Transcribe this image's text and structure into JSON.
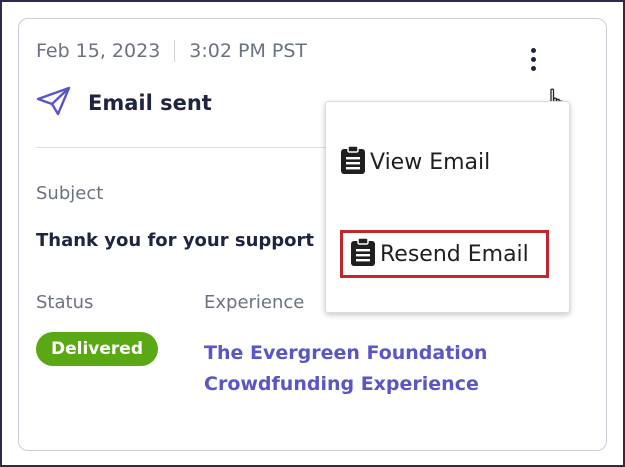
{
  "activity": {
    "date": "Feb 15, 2023",
    "time": "3:02 PM PST",
    "event_label": "Email sent"
  },
  "details": {
    "subject_label": "Subject",
    "subject_value": "Thank you for your support",
    "status_label": "Status",
    "status_value": "Delivered",
    "experience_label": "Experience",
    "experience_line1": "The Evergreen Foundation",
    "experience_line2": "Crowdfunding Experience"
  },
  "menu": {
    "items": [
      {
        "label": "View Email",
        "icon": "clipboard-icon"
      },
      {
        "label": "Resend Email",
        "icon": "clipboard-icon"
      }
    ]
  },
  "colors": {
    "accent": "#5a56c4",
    "status_delivered": "#59a814",
    "highlight": "#c0272d",
    "text_dark": "#1f2440",
    "text_muted": "#6b7280"
  }
}
